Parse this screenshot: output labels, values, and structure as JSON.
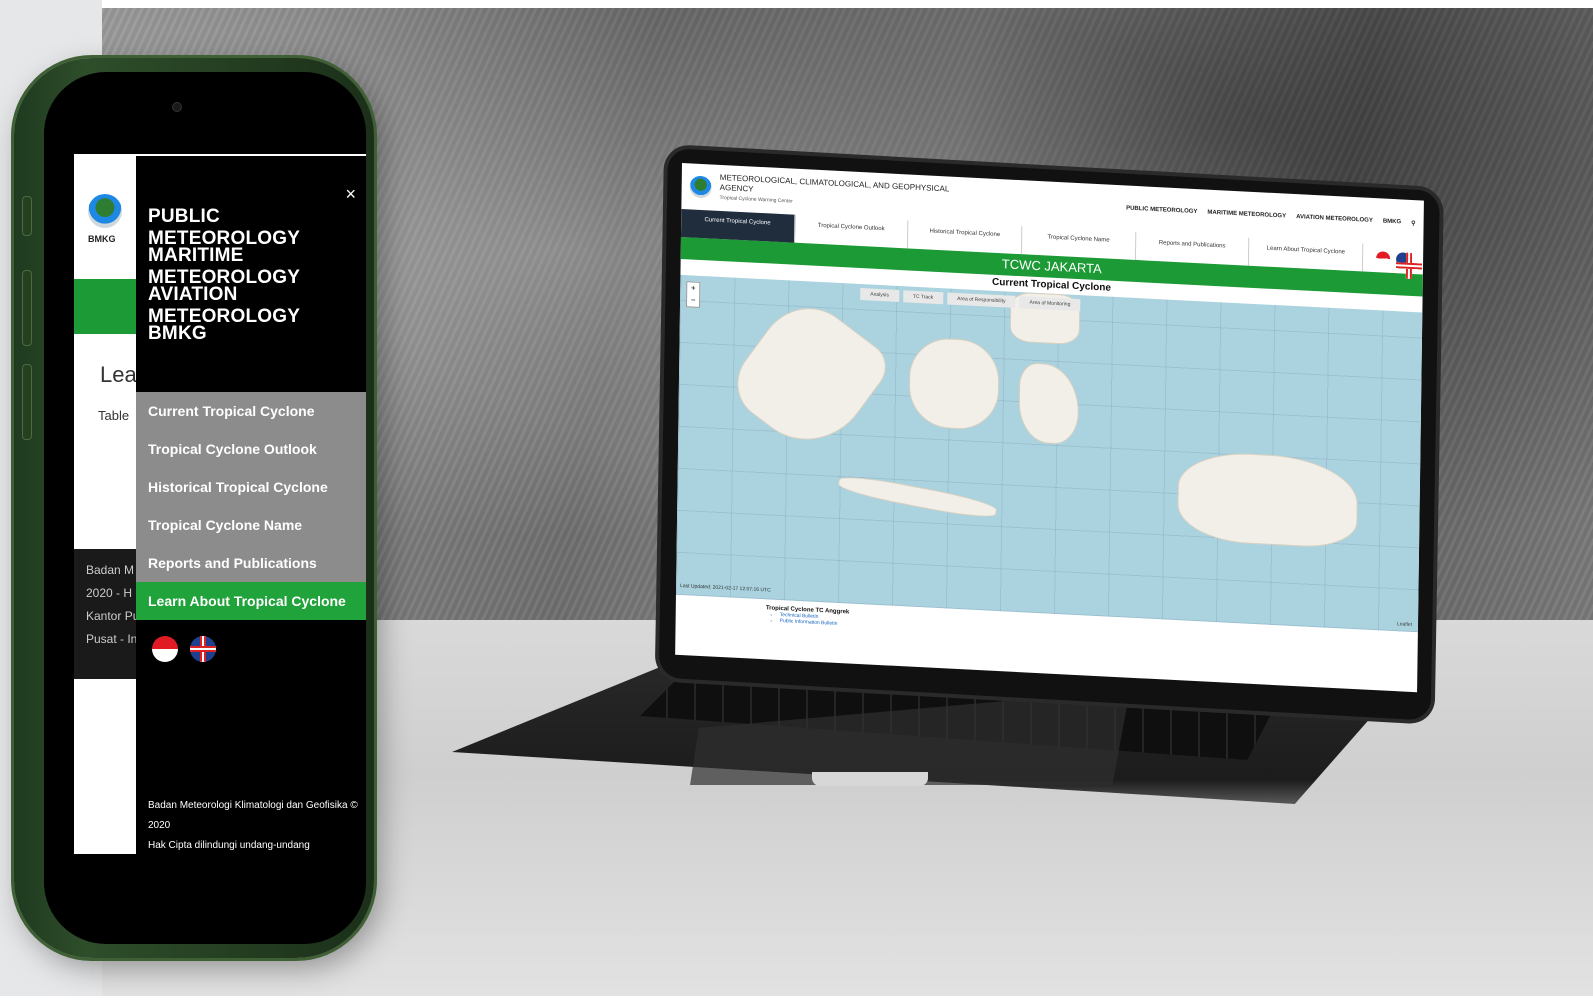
{
  "phone": {
    "header_logo_text": "BMKG",
    "learn_heading": "Lear",
    "table_label": "Table",
    "footer_lines": [
      "Badan M",
      "2020 - H",
      "Kantor Pu",
      "Pusat - In"
    ],
    "drawer": {
      "close_label": "×",
      "main_menu": [
        "PUBLIC METEOROLOGY",
        "MARITIME METEOROLOGY",
        "AVIATION METEOROLOGY",
        "BMKG"
      ],
      "sub_menu": [
        "Current Tropical Cyclone",
        "Tropical Cyclone Outlook",
        "Historical Tropical Cyclone",
        "Tropical Cyclone Name",
        "Reports and Publications",
        "Learn About Tropical Cyclone"
      ],
      "active_item": "Learn About Tropical Cyclone",
      "copyright_line1": "Badan Meteorologi Klimatologi dan Geofisika © 2020",
      "copyright_line2": "Hak Cipta dilindungi undang-undang"
    }
  },
  "laptop": {
    "agency_name": "METEOROLOGICAL, CLIMATOLOGICAL, AND GEOPHYSICAL AGENCY",
    "agency_sub": "Tropical Cyclone Warning Center",
    "logo_text": "BMKG",
    "top_nav": [
      "PUBLIC METEOROLOGY",
      "MARITIME METEOROLOGY",
      "AVIATION METEOROLOGY",
      "BMKG"
    ],
    "search_icon": "search-icon",
    "tabs": [
      "Current Tropical Cyclone",
      "Tropical Cyclone Outlook",
      "Historical Tropical Cyclone",
      "Tropical Cyclone Name",
      "Reports and Publications",
      "Learn About Tropical Cyclone"
    ],
    "banner": "TCWC JAKARTA",
    "section_title": "Current Tropical Cyclone",
    "map_tabs": [
      "Analysis",
      "TC Track",
      "Area of Responsibility",
      "Area of Monitoring"
    ],
    "zoom_in": "+",
    "zoom_out": "−",
    "last_updated": "Last Updated: 2021-02-17 12:07:16 UTC",
    "cyclone_title": "Tropical Cyclone TC Anggrek",
    "cyclone_links": [
      "Technical Bulletin",
      "Public Information Bulletin"
    ],
    "map_credit": "Leaflet"
  },
  "colors": {
    "brand_green": "#1c9a35",
    "active_tab_navy": "#1f2d3d",
    "drawer_bg": "#000000",
    "submenu_gray": "#8c8c8c"
  }
}
